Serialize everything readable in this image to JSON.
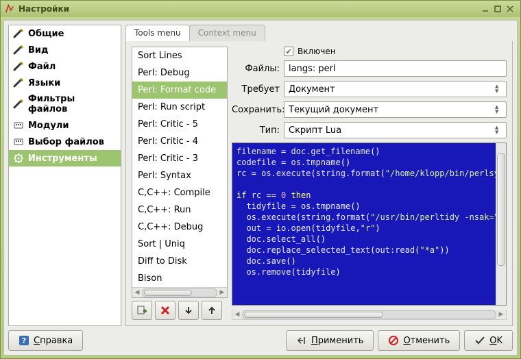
{
  "window": {
    "title": "Настройки"
  },
  "sidebar": {
    "items": [
      {
        "label": "Общие",
        "icon": "pref-general-icon"
      },
      {
        "label": "Вид",
        "icon": "pref-view-icon"
      },
      {
        "label": "Файл",
        "icon": "pref-file-icon"
      },
      {
        "label": "Языки",
        "icon": "pref-langs-icon"
      },
      {
        "label": "Фильтры файлов",
        "icon": "pref-filters-icon"
      },
      {
        "label": "Модули",
        "icon": "pref-modules-icon"
      },
      {
        "label": "Выбор файлов",
        "icon": "pref-fileselect-icon"
      },
      {
        "label": "Инструменты",
        "icon": "pref-tools-icon",
        "selected": true
      }
    ]
  },
  "tabs": {
    "items": [
      {
        "label": "Tools menu",
        "active": true
      },
      {
        "label": "Context menu"
      }
    ]
  },
  "tools": {
    "items": [
      {
        "label": "Sort Lines"
      },
      {
        "label": "Perl: Debug"
      },
      {
        "label": "Perl: Format code",
        "selected": true
      },
      {
        "label": "Perl: Run script"
      },
      {
        "label": "Perl: Critic - 5"
      },
      {
        "label": "Perl: Critic - 4"
      },
      {
        "label": "Perl: Critic - 3"
      },
      {
        "label": "Perl: Syntax"
      },
      {
        "label": "C,C++: Compile"
      },
      {
        "label": "C,C++: Run"
      },
      {
        "label": "C,C++: Debug"
      },
      {
        "label": "Sort | Uniq"
      },
      {
        "label": "Diff to Disk"
      },
      {
        "label": "Bison"
      }
    ]
  },
  "form": {
    "enabled_label": "Включен",
    "enabled_checked": true,
    "files_label": "Файлы:",
    "files_value": "langs: perl",
    "requires_label": "Требует",
    "requires_value": "Документ",
    "save_label": "Сохранить:",
    "save_value": "Текущий документ",
    "type_label": "Тип:",
    "type_value": "Скрипт Lua"
  },
  "code": {
    "lines": [
      [
        [
          "id",
          "filename"
        ],
        [
          "op",
          " = "
        ],
        [
          "id",
          "doc.get_filename"
        ],
        [
          "op",
          "()"
        ]
      ],
      [
        [
          "id",
          "codefile"
        ],
        [
          "op",
          " = "
        ],
        [
          "id",
          "os.tmpname"
        ],
        [
          "op",
          "()"
        ]
      ],
      [
        [
          "id",
          "rc"
        ],
        [
          "op",
          " = "
        ],
        [
          "id",
          "os.execute"
        ],
        [
          "op",
          "("
        ],
        [
          "id",
          "string.format"
        ],
        [
          "op",
          "("
        ],
        [
          "str",
          "\"/home/klopp/bin/perlsy"
        ]
      ],
      [
        [
          "op",
          ""
        ]
      ],
      [
        [
          "kw",
          "if"
        ],
        [
          "op",
          " "
        ],
        [
          "id",
          "rc"
        ],
        [
          "op",
          " == "
        ],
        [
          "num",
          "0"
        ],
        [
          "op",
          " "
        ],
        [
          "kw",
          "then"
        ]
      ],
      [
        [
          "op",
          "  "
        ],
        [
          "id",
          "tidyfile"
        ],
        [
          "op",
          " = "
        ],
        [
          "id",
          "os.tmpname"
        ],
        [
          "op",
          "()"
        ]
      ],
      [
        [
          "op",
          "  "
        ],
        [
          "id",
          "os.execute"
        ],
        [
          "op",
          "("
        ],
        [
          "id",
          "string.format"
        ],
        [
          "op",
          "("
        ],
        [
          "str",
          "\"/usr/bin/perltidy -nsak=\\"
        ]
      ],
      [
        [
          "op",
          "  "
        ],
        [
          "id",
          "out"
        ],
        [
          "op",
          " = "
        ],
        [
          "id",
          "io.open"
        ],
        [
          "op",
          "("
        ],
        [
          "id",
          "tidyfile"
        ],
        [
          "op",
          ","
        ],
        [
          "str",
          "\"r\""
        ],
        [
          "op",
          ")"
        ]
      ],
      [
        [
          "op",
          "  "
        ],
        [
          "id",
          "doc.select_all"
        ],
        [
          "op",
          "()"
        ]
      ],
      [
        [
          "op",
          "  "
        ],
        [
          "id",
          "doc.replace_selected_text"
        ],
        [
          "op",
          "("
        ],
        [
          "id",
          "out:read"
        ],
        [
          "op",
          "("
        ],
        [
          "str",
          "\"*a\""
        ],
        [
          "op",
          "))"
        ]
      ],
      [
        [
          "op",
          "  "
        ],
        [
          "id",
          "doc.save"
        ],
        [
          "op",
          "()"
        ]
      ],
      [
        [
          "op",
          "  "
        ],
        [
          "id",
          "os.remove"
        ],
        [
          "op",
          "("
        ],
        [
          "id",
          "tidyfile"
        ],
        [
          "op",
          ")"
        ]
      ]
    ]
  },
  "footer": {
    "help": "Справка",
    "apply": "Применить",
    "cancel": "Отменить",
    "ok": "OK"
  }
}
